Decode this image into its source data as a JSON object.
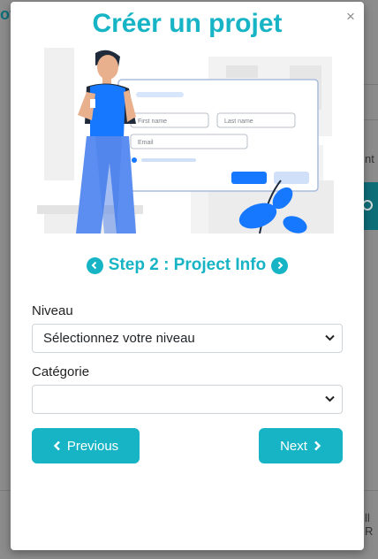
{
  "modal": {
    "title": "Créer un projet",
    "close_label": "×"
  },
  "step": {
    "label": "Step 2 : Project Info",
    "prev_icon": "chevron-left-circle-icon",
    "next_icon": "chevron-right-circle-icon"
  },
  "illustration": {
    "first_name": "First name",
    "last_name": "Last name",
    "email": "Email"
  },
  "form": {
    "niveau_label": "Niveau",
    "niveau_value": "Sélectionnez votre niveau",
    "categorie_label": "Catégorie",
    "categorie_value": ""
  },
  "buttons": {
    "previous": "Previous",
    "next": "Next"
  },
  "colors": {
    "accent": "#17b4c6",
    "primary_blue": "#1677ff"
  },
  "background": {
    "top_left_text": "ot",
    "right_text_1": "nt",
    "right_text_2": "ll R"
  }
}
